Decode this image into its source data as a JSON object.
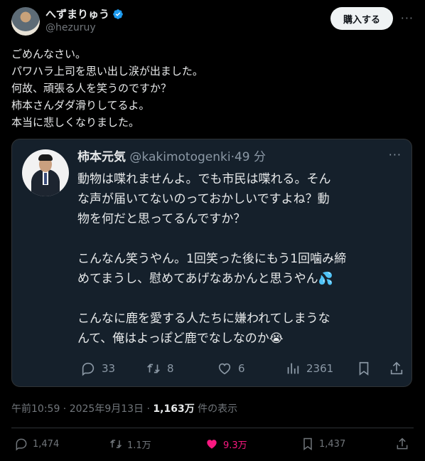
{
  "tweet": {
    "author_name": "へずまりゅう",
    "author_handle": "@hezuruy",
    "buy_label": "購入する",
    "more_label": "···",
    "text_lines": [
      "ごめんなさい。",
      "パワハラ上司を思い出し涙が出ました。",
      "何故、頑張る人を笑うのですか？",
      "柿本さんダダ滑りしてるよ。",
      "本当に悲しくなりました。"
    ],
    "meta": {
      "time": "午前10:59 · 2025年9月13日 · ",
      "views": "1,163万",
      "views_suffix": " 件の表示"
    },
    "actions": {
      "replies": "1,474",
      "retweets": "1.1万",
      "likes": "9.3万",
      "bookmarks": "1,437"
    }
  },
  "quote": {
    "name": "柿本元気",
    "handle": "@kakimotogenki",
    "time": "·49 分",
    "more_label": "···",
    "lines": [
      "動物は喋れませんよ。でも市民は喋れる。そん",
      "な声が届いてないのっておかしいですよね？動",
      "物を何だと思ってるんですか？",
      "",
      "こんなん笑うやん。1回笑った後にもう1回噛み締",
      "めてまうし、慰めてあげなあかんと思うやん💦",
      "",
      "こんなに鹿を愛する人たちに嫌われてしまうな",
      "んて、俺はよっぽど鹿でなしなのか😭"
    ],
    "actions": {
      "replies": "33",
      "retweets": "8",
      "likes": "6",
      "views": "2361"
    }
  },
  "colors": {
    "background": "#000000",
    "quote_background": "#15202b",
    "accent_blue": "#1d9bf0",
    "like_pink": "#f91880",
    "muted": "#71767b"
  },
  "icons": [
    "verified-badge-icon",
    "reply-icon",
    "retweet-icon",
    "like-icon",
    "views-icon",
    "bookmark-icon",
    "share-icon"
  ]
}
